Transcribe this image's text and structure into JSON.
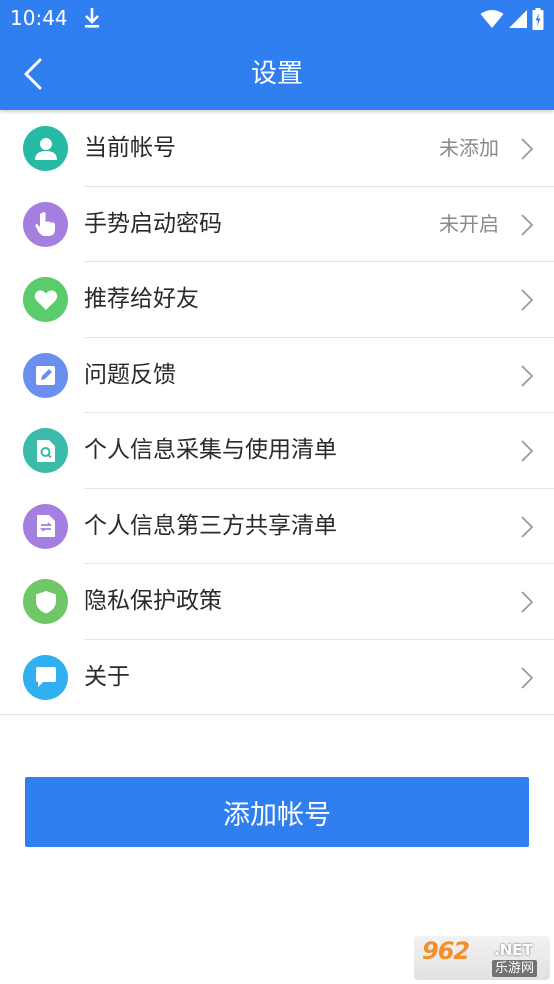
{
  "status_bar": {
    "time": "10:44"
  },
  "app_bar": {
    "title": "设置"
  },
  "settings": [
    {
      "label": "当前帐号",
      "value": "未添加",
      "icon": "person-icon",
      "color": "#26b9a4"
    },
    {
      "label": "手势启动密码",
      "value": "未开启",
      "icon": "hand-pointer-icon",
      "color": "#a57fe0"
    },
    {
      "label": "推荐给好友",
      "value": "",
      "icon": "heart-icon",
      "color": "#5ccb6c"
    },
    {
      "label": "问题反馈",
      "value": "",
      "icon": "edit-icon",
      "color": "#6b8ff0"
    },
    {
      "label": "个人信息采集与使用清单",
      "value": "",
      "icon": "document-search-icon",
      "color": "#3bbba9"
    },
    {
      "label": "个人信息第三方共享清单",
      "value": "",
      "icon": "document-share-icon",
      "color": "#a57fe0"
    },
    {
      "label": "隐私保护政策",
      "value": "",
      "icon": "shield-icon",
      "color": "#6fc766"
    },
    {
      "label": "关于",
      "value": "",
      "icon": "chat-bubble-icon",
      "color": "#2fb0f0"
    }
  ],
  "add_account_button": {
    "label": "添加帐号"
  },
  "watermark": {
    "num": "962",
    "net": ".NET",
    "cn": "乐游网"
  },
  "colors": {
    "primary": "#2f7ff0",
    "divider": "#e4e4e4",
    "secondary_text": "#8a8a8a"
  }
}
